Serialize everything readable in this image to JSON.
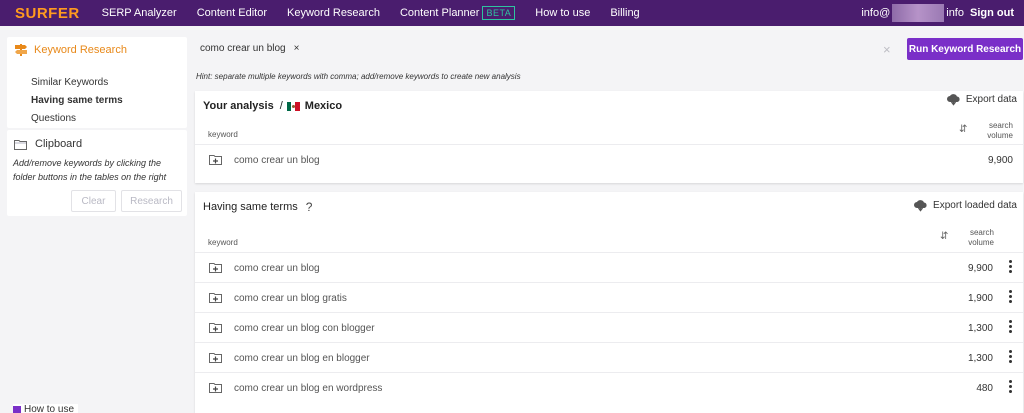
{
  "nav": {
    "logo": "SURFER",
    "items": [
      "SERP Analyzer",
      "Content Editor",
      "Keyword Research",
      "Content Planner",
      "How to use",
      "Billing"
    ],
    "beta_badge": "BETA",
    "user_prefix": "info@",
    "user_suffix": "info",
    "signout": "Sign out"
  },
  "sidebar": {
    "keyword_research_label": "Keyword Research",
    "subitems": [
      "Similar Keywords",
      "Having same terms",
      "Questions"
    ],
    "clipboard_label": "Clipboard",
    "clipboard_hint": "Add/remove keywords by clicking the folder buttons in the tables on the right",
    "clear_button": "Clear",
    "research_button": "Research",
    "how_to_use": "How to use"
  },
  "search": {
    "chip": "como crear un blog",
    "chip_close": "×",
    "clear_all": "×",
    "run_button": "Run Keyword Research",
    "hint": "Hint: separate multiple keywords with comma; add/remove keywords to create new analysis"
  },
  "analysis": {
    "title": "Your analysis",
    "separator": "/",
    "country": "Mexico",
    "export": "Export data",
    "col_keyword": "keyword",
    "col_volume_1": "search",
    "col_volume_2": "volume",
    "sort_icon": "⇵",
    "rows": [
      {
        "keyword": "como crear un blog",
        "volume": "9,900"
      }
    ]
  },
  "same_terms": {
    "title": "Having same terms",
    "help": "?",
    "export": "Export loaded data",
    "col_keyword": "keyword",
    "col_volume_1": "search",
    "col_volume_2": "volume",
    "sort_icon": "⇵",
    "rows": [
      {
        "keyword": "como crear un blog",
        "volume": "9,900"
      },
      {
        "keyword": "como crear un blog gratis",
        "volume": "1,900"
      },
      {
        "keyword": "como crear un blog con blogger",
        "volume": "1,300"
      },
      {
        "keyword": "como crear un blog en blogger",
        "volume": "1,300"
      },
      {
        "keyword": "como crear un blog en wordpress",
        "volume": "480"
      }
    ]
  },
  "colors": {
    "topbar": "#4a1d6e",
    "logo": "#ff9a1f",
    "accent": "#7a2fc8",
    "beta": "#2ec4a0",
    "keyword_research": "#e8891a"
  }
}
